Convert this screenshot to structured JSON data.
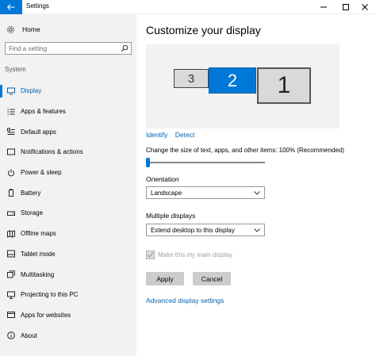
{
  "window": {
    "title": "Settings",
    "controls": [
      "minimize",
      "maximize",
      "close"
    ]
  },
  "sidebar": {
    "home_label": "Home",
    "search_placeholder": "Find a setting",
    "section_label": "System",
    "items": [
      {
        "label": "Display",
        "icon": "display-icon",
        "active": true
      },
      {
        "label": "Apps & features",
        "icon": "apps-list-icon"
      },
      {
        "label": "Default apps",
        "icon": "default-apps-icon"
      },
      {
        "label": "Notifications & actions",
        "icon": "notifications-icon"
      },
      {
        "label": "Power & sleep",
        "icon": "power-icon"
      },
      {
        "label": "Battery",
        "icon": "battery-icon"
      },
      {
        "label": "Storage",
        "icon": "storage-icon"
      },
      {
        "label": "Offline maps",
        "icon": "map-icon"
      },
      {
        "label": "Tablet mode",
        "icon": "tablet-icon"
      },
      {
        "label": "Multitasking",
        "icon": "multitasking-icon"
      },
      {
        "label": "Projecting to this PC",
        "icon": "projecting-icon"
      },
      {
        "label": "Apps for websites",
        "icon": "apps-websites-icon"
      },
      {
        "label": "About",
        "icon": "info-icon"
      }
    ]
  },
  "main": {
    "heading": "Customize your display",
    "monitors": [
      {
        "number": "3",
        "selected": false
      },
      {
        "number": "2",
        "selected": true
      },
      {
        "number": "1",
        "selected": false
      }
    ],
    "identify_label": "Identify",
    "detect_label": "Detect",
    "scale_label": "Change the size of text, apps, and other items: 100% (Recommended)",
    "scale_slider_fraction": 0.0,
    "orientation_label": "Orientation",
    "orientation_value": "Landscape",
    "multiple_displays_label": "Multiple displays",
    "multiple_displays_value": "Extend desktop to this display",
    "main_display_label": "Make this my main display",
    "main_display_checked": true,
    "main_display_disabled": true,
    "apply_label": "Apply",
    "cancel_label": "Cancel",
    "advanced_label": "Advanced display settings"
  },
  "colors": {
    "accent": "#0078d7",
    "link": "#0063b1",
    "sidebar_bg": "#f2f2f2",
    "button_bg": "#cccccc"
  }
}
